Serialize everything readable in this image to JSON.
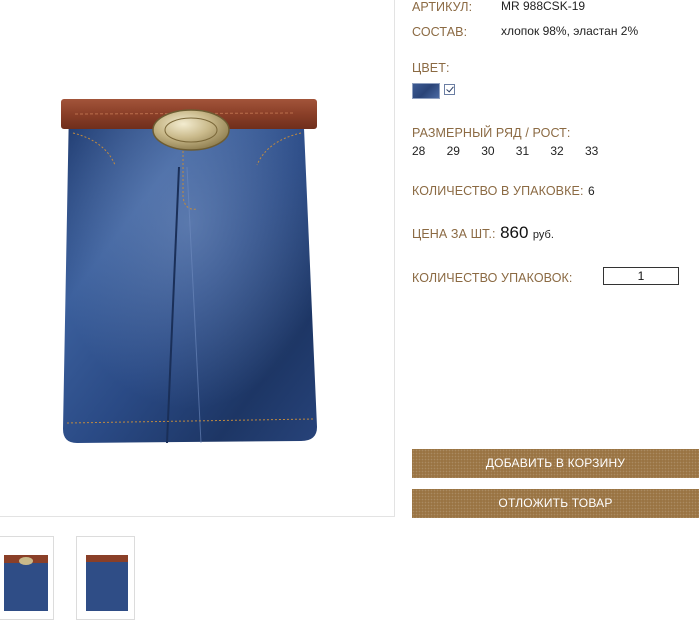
{
  "product": {
    "article_label": "АРТИКУЛ:",
    "article_value": "MR 988CSK-19",
    "composition_label": "СОСТАВ:",
    "composition_value": "хлопок 98%, эластан 2%",
    "color_label": "ЦВЕТ:",
    "color_swatch": "#34518a",
    "color_checked": true,
    "sizes_label": "РАЗМЕРНЫЙ РЯД / РОСТ:",
    "sizes": [
      "28",
      "29",
      "30",
      "31",
      "32",
      "33"
    ],
    "pack_qty_label": "КОЛИЧЕСТВО В УПАКОВКЕ:",
    "pack_qty_value": "6",
    "price_label": "ЦЕНА ЗА ШТ.:",
    "price_value": "860",
    "price_currency": "руб.",
    "packs_label": "КОЛИЧЕСТВО УПАКОВОК:",
    "packs_value": "1"
  },
  "buttons": {
    "add_to_cart": "ДОБАВИТЬ В КОРЗИНУ",
    "defer": "ОТЛОЖИТЬ ТОВАР"
  },
  "colors": {
    "label": "#8b6a43",
    "button": "#9a7443",
    "denim": "#2f4d86"
  },
  "images": {
    "main": "denim-skirt-with-brown-belt",
    "thumbnails": [
      "denim-skirt-front",
      "denim-skirt-side"
    ]
  }
}
